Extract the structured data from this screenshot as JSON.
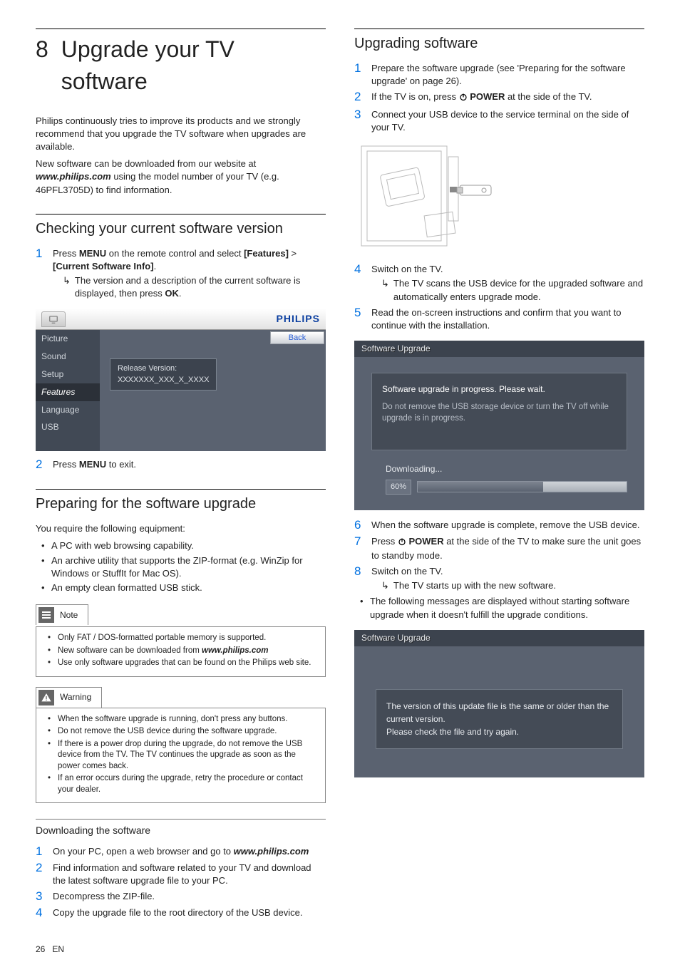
{
  "page": {
    "number": "26",
    "lang": "EN"
  },
  "chapter": {
    "number": "8",
    "title": "Upgrade your TV software"
  },
  "intro": {
    "p1": "Philips continuously tries to improve its products and we strongly recommend that you upgrade the TV software when upgrades are available.",
    "p2a": "New software can be downloaded from our website at ",
    "p2_url": "www.philips.com",
    "p2b": " using the model number of your TV (e.g. 46PFL3705D) to find information."
  },
  "check": {
    "heading": "Checking your current software version",
    "step1_n": "1",
    "step1_a": "Press ",
    "step1_menu": "MENU",
    "step1_b": " on the remote control and select ",
    "step1_feat": "[Features]",
    "step1_gt": " > ",
    "step1_csi": "[Current Software Info]",
    "step1_dot": ".",
    "step1_sub_a": "The version and a description of the current software is displayed, then press ",
    "step1_sub_ok": "OK",
    "step1_sub_b": ".",
    "step2_n": "2",
    "step2_a": "Press ",
    "step2_menu": "MENU",
    "step2_b": " to exit."
  },
  "tvmenu": {
    "brand": "PHILIPS",
    "back": "Back",
    "items": [
      "Picture",
      "Sound",
      "Setup",
      "Features",
      "Language",
      "USB"
    ],
    "release_label": "Release Version:",
    "release_value": "XXXXXXX_XXX_X_XXXX"
  },
  "prep": {
    "heading": "Preparing for the software upgrade",
    "intro": "You require the following equipment:",
    "bullets": [
      "A PC with web browsing capability.",
      "An archive utility that supports the ZIP-format (e.g. WinZip for Windows or StuffIt for Mac OS).",
      "An empty clean formatted USB stick."
    ],
    "note_label": "Note",
    "note_bullets_a": "Only FAT / DOS-formatted portable memory is supported.",
    "note_bullets_b_pre": "New software can be downloaded from ",
    "note_bullets_b_url": "www.philips.com",
    "note_bullets_c": "Use only software upgrades that can be found on the Philips web site.",
    "warn_label": "Warning",
    "warn_bullets": [
      "When the software upgrade is running, don't press any buttons.",
      "Do not remove the USB device during the software upgrade.",
      "If there is a power drop during the upgrade, do not remove the USB device from the TV. The TV continues the upgrade as soon as the power comes back.",
      "If an error occurs during the upgrade, retry the procedure or contact your dealer."
    ]
  },
  "download": {
    "heading": "Downloading the software",
    "s1_n": "1",
    "s1_a": "On your PC, open a web browser and go to ",
    "s1_url": "www.philips.com",
    "s2_n": "2",
    "s2": "Find information and software related to your TV and download the latest software upgrade file to your PC.",
    "s3_n": "3",
    "s3": "Decompress the ZIP-file.",
    "s4_n": "4",
    "s4": "Copy the upgrade file to the root directory of the USB device."
  },
  "upgrade": {
    "heading": "Upgrading software",
    "s1_n": "1",
    "s1": "Prepare the software upgrade (see 'Preparing for the software upgrade' on page 26).",
    "s2_n": "2",
    "s2_a": "If the TV is on, press ",
    "s2_pow": "POWER",
    "s2_b": " at the side of the TV.",
    "s3_n": "3",
    "s3": "Connect your USB device to the service terminal on the side of your TV.",
    "s4_n": "4",
    "s4": "Switch on the TV.",
    "s4_sub": "The TV scans the USB device for the upgraded software and automatically enters upgrade mode.",
    "s5_n": "5",
    "s5": "Read the on-screen instructions and confirm that you want to continue with the installation.",
    "s6_n": "6",
    "s6": "When the software upgrade is complete, remove the USB device.",
    "s7_n": "7",
    "s7_a": "Press ",
    "s7_pow": "POWER",
    "s7_b": " at the side of the TV to make sure the unit goes to standby mode.",
    "s8_n": "8",
    "s8": "Switch on the TV.",
    "s8_sub": "The TV starts up with the new software.",
    "extra": "The following messages are displayed without starting software upgrade when it doesn't fulfill the upgrade conditions."
  },
  "swbox": {
    "title": "Software Upgrade",
    "line1": "Software upgrade in progress. Please wait.",
    "line2": "Do not remove the USB storage device or turn the TV off while upgrade is in progress.",
    "downloading": "Downloading...",
    "percent": "60%"
  },
  "swbox2": {
    "title": "Software Upgrade",
    "msg": "The version of this update file is the same or older than the current version.\nPlease check the file and try again."
  }
}
